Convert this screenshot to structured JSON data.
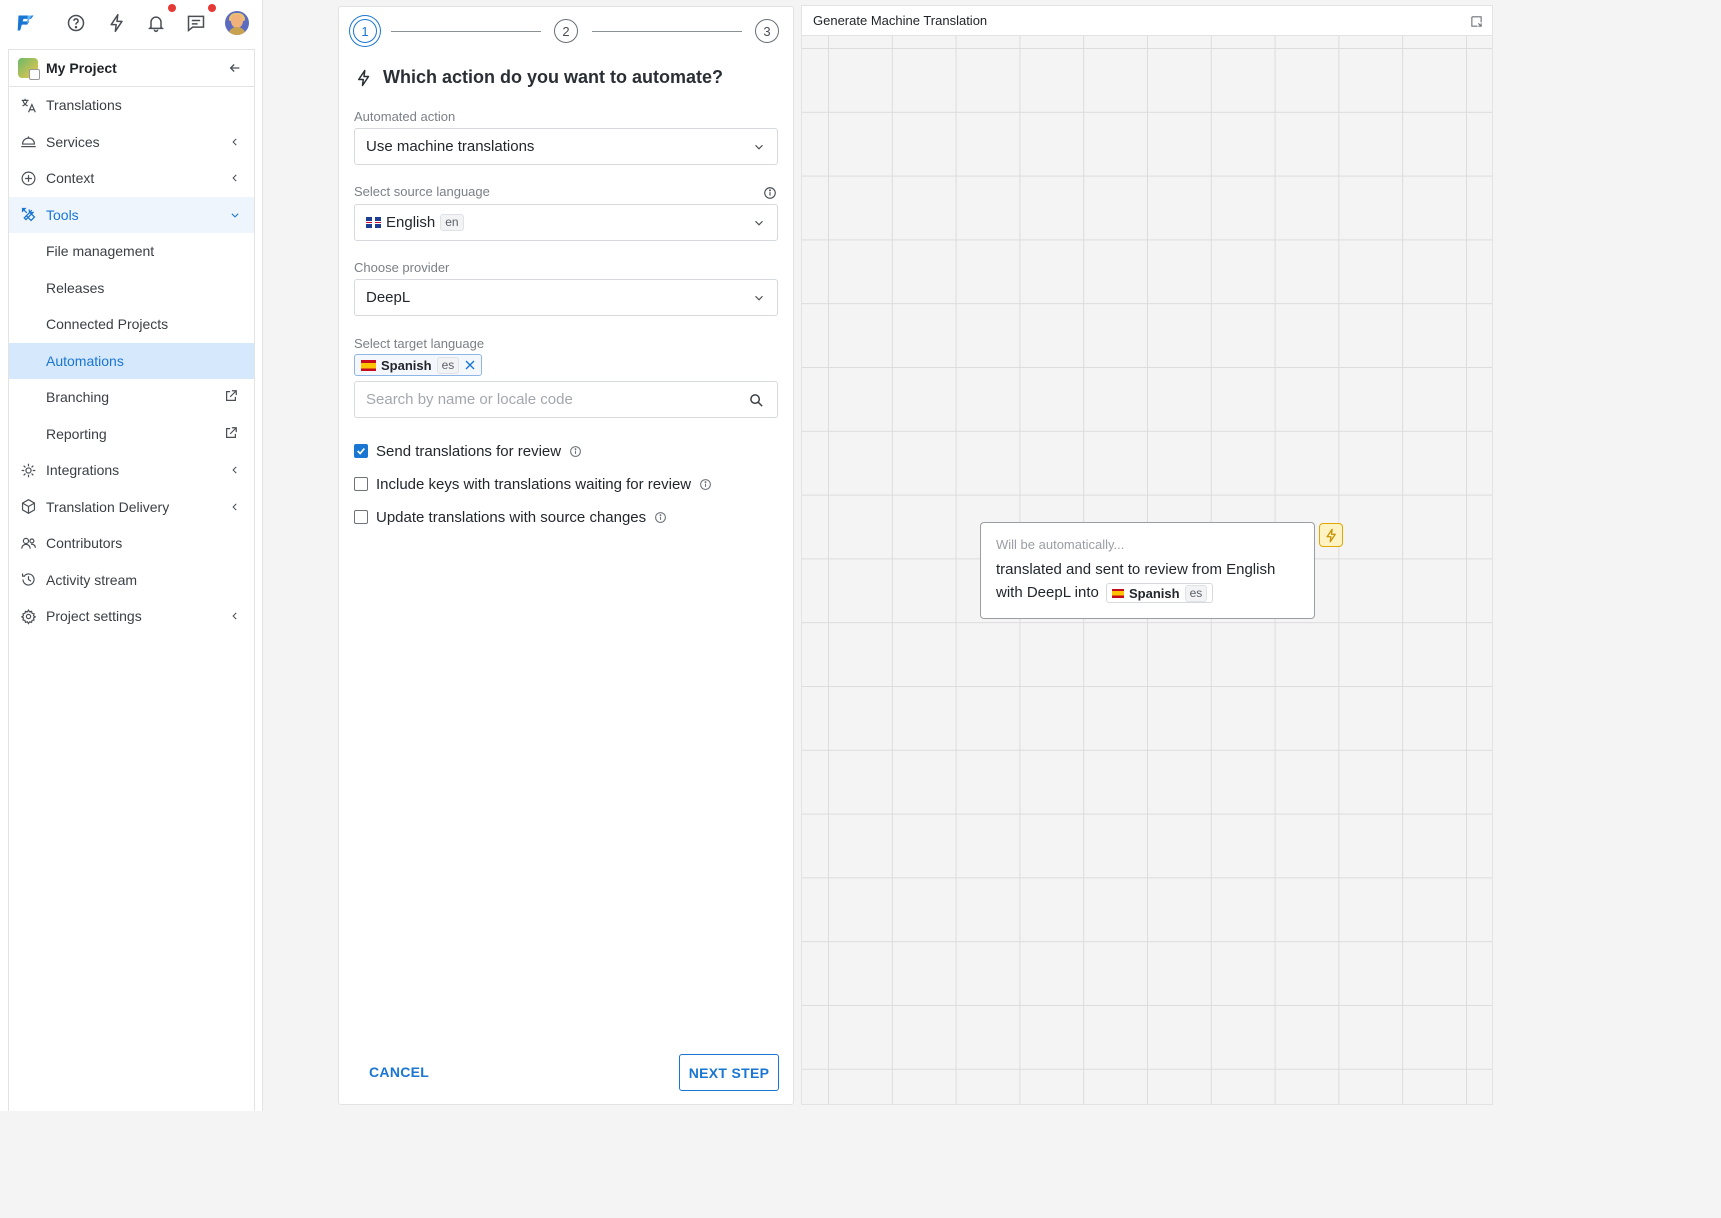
{
  "topbar": {
    "icons": [
      "logo-icon",
      "help-icon",
      "bolt-icon",
      "bell-icon",
      "chat-icon",
      "avatar"
    ]
  },
  "sidebar": {
    "project_name": "My Project",
    "items": [
      {
        "label": "Translations",
        "icon": "translate-icon"
      },
      {
        "label": "Services",
        "icon": "services-icon",
        "chevron": "left"
      },
      {
        "label": "Context",
        "icon": "plus-circle-icon",
        "chevron": "left"
      },
      {
        "label": "Tools",
        "icon": "tools-icon",
        "chevron": "down",
        "expanded": true
      },
      {
        "label": "File management"
      },
      {
        "label": "Releases"
      },
      {
        "label": "Connected Projects"
      },
      {
        "label": "Automations",
        "selected": true
      },
      {
        "label": "Branching",
        "external": true
      },
      {
        "label": "Reporting",
        "external": true
      },
      {
        "label": "Integrations",
        "icon": "integrations-icon",
        "chevron": "left"
      },
      {
        "label": "Translation Delivery",
        "icon": "delivery-icon",
        "chevron": "left"
      },
      {
        "label": "Contributors",
        "icon": "people-icon"
      },
      {
        "label": "Activity stream",
        "icon": "history-icon"
      },
      {
        "label": "Project settings",
        "icon": "gear-icon",
        "chevron": "left"
      }
    ]
  },
  "wizard": {
    "steps": [
      "1",
      "2",
      "3"
    ],
    "current_step": 1,
    "title": "Which action do you want to automate?",
    "automated_action": {
      "label": "Automated action",
      "value": "Use machine translations"
    },
    "source_language": {
      "label": "Select source language",
      "name": "English",
      "code": "en"
    },
    "provider": {
      "label": "Choose provider",
      "value": "DeepL"
    },
    "target_language": {
      "label": "Select target language",
      "tags": [
        {
          "name": "Spanish",
          "code": "es"
        }
      ],
      "search_placeholder": "Search by name or locale code"
    },
    "options": [
      {
        "label": "Send translations for review",
        "checked": true
      },
      {
        "label": "Include keys with translations waiting for review",
        "checked": false
      },
      {
        "label": "Update translations with source changes",
        "checked": false
      }
    ],
    "cancel_label": "CANCEL",
    "next_label": "NEXT STEP"
  },
  "canvas": {
    "title": "Generate Machine Translation",
    "node": {
      "hint": "Will be automatically...",
      "text_before": "translated and sent to review from English with DeepL into",
      "lang_name": "Spanish",
      "lang_code": "es"
    }
  },
  "colors": {
    "accent": "#1976d2",
    "notification_dot": "#e53935",
    "bolt_badge": "#fff3c4"
  }
}
